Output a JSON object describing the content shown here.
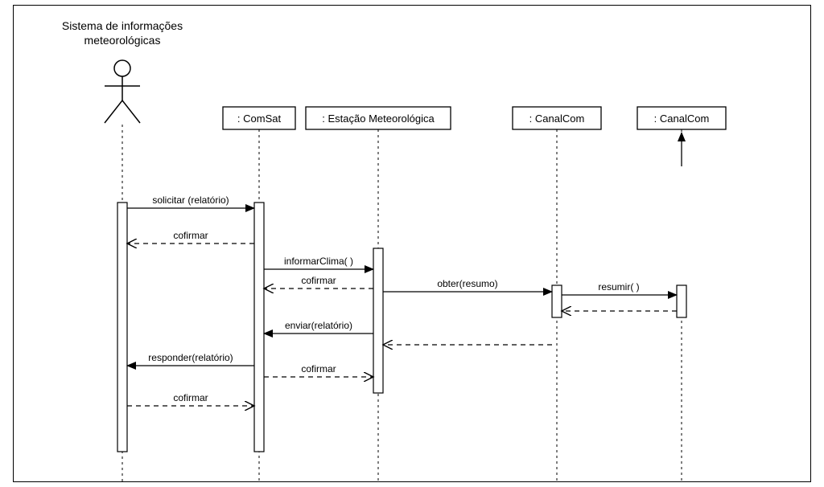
{
  "actor": {
    "title_line1": "Sistema de informações",
    "title_line2": "meteorológicas"
  },
  "lifelines": {
    "comsat": ": ComSat",
    "estacao": ": Estação Meteorológica",
    "canal1": ": CanalCom",
    "canal2": ": CanalCom"
  },
  "messages": {
    "m1": "solicitar (relatório)",
    "m2": "cofirmar",
    "m3": "informarClima( )",
    "m4": "cofirmar",
    "m5": "obter(resumo)",
    "m6": "resumir( )",
    "m7": "enviar(relatório)",
    "m8": "responder(relatório)",
    "m9": "cofirmar",
    "m10": "cofirmar"
  },
  "chart_data": {
    "type": "uml-sequence-diagram",
    "actors": [
      {
        "id": "sys",
        "label": "Sistema de informações meteorológicas",
        "kind": "actor"
      },
      {
        "id": "comsat",
        "label": ": ComSat",
        "kind": "object"
      },
      {
        "id": "estacao",
        "label": ": Estação Meteorológica",
        "kind": "object"
      },
      {
        "id": "canal1",
        "label": ": CanalCom",
        "kind": "object"
      },
      {
        "id": "canal2",
        "label": ": CanalCom",
        "kind": "object"
      }
    ],
    "messages": [
      {
        "from": "sys",
        "to": "comsat",
        "label": "solicitar (relatório)",
        "style": "sync"
      },
      {
        "from": "comsat",
        "to": "sys",
        "label": "cofirmar",
        "style": "return"
      },
      {
        "from": "comsat",
        "to": "estacao",
        "label": "informarClima( )",
        "style": "sync"
      },
      {
        "from": "estacao",
        "to": "comsat",
        "label": "cofirmar",
        "style": "return"
      },
      {
        "from": "estacao",
        "to": "canal1",
        "label": "obter(resumo)",
        "style": "sync"
      },
      {
        "from": "canal1",
        "to": "canal2",
        "label": "resumir( )",
        "style": "sync"
      },
      {
        "from": "canal2",
        "to": "canal1",
        "label": "",
        "style": "return"
      },
      {
        "from": "canal1",
        "to": "estacao",
        "label": "",
        "style": "return"
      },
      {
        "from": "estacao",
        "to": "comsat",
        "label": "enviar(relatório)",
        "style": "sync"
      },
      {
        "from": "comsat",
        "to": "sys",
        "label": "responder(relatório)",
        "style": "sync"
      },
      {
        "from": "comsat",
        "to": "estacao",
        "label": "cofirmar",
        "style": "return"
      },
      {
        "from": "sys",
        "to": "comsat",
        "label": "cofirmar",
        "style": "return"
      }
    ]
  }
}
